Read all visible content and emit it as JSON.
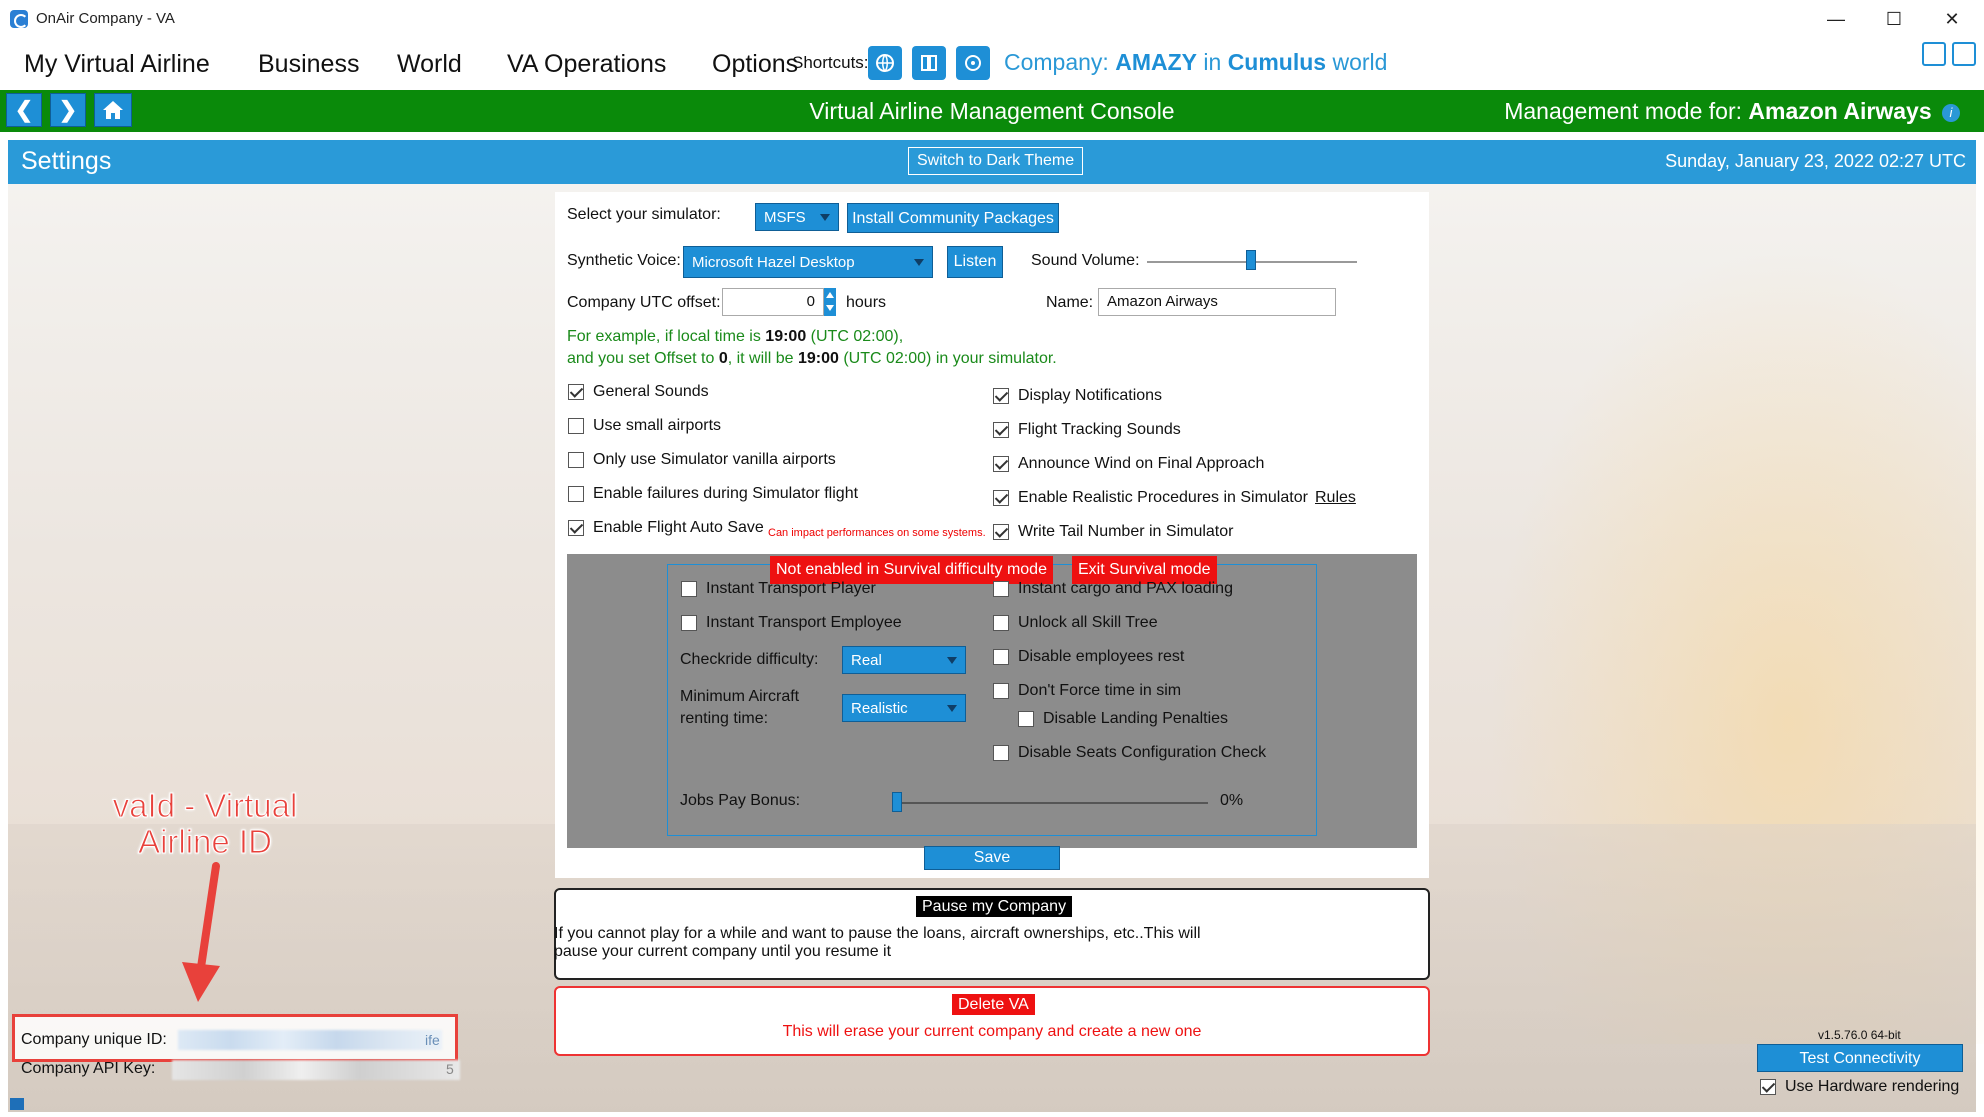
{
  "window": {
    "title": "OnAir Company - VA",
    "minimize_glyph": "—",
    "maximize_glyph": "☐",
    "close_glyph": "✕"
  },
  "menu": {
    "items": [
      "My Virtual Airline",
      "Business",
      "World",
      "VA Operations",
      "Options"
    ],
    "shortcuts_label": "Shortcuts:",
    "shortcut_icons": [
      "globe-icon",
      "map-book-icon",
      "refresh-badge-icon"
    ],
    "company_prefix": "Company:",
    "company_name": "AMAZY",
    "company_in": "in",
    "world_name": "Cumulus",
    "world_suffix": "world"
  },
  "navbar": {
    "back_glyph": "❮",
    "forward_glyph": "❯",
    "home_glyph": "⌂",
    "console_title": "Virtual Airline Management Console",
    "mgmt_prefix": "Management mode for:",
    "mgmt_company": "Amazon Airways",
    "info_glyph": "i"
  },
  "settings_header": {
    "title": "Settings",
    "theme_button": "Switch to Dark Theme",
    "datetime": "Sunday, January 23, 2022 02:27 UTC"
  },
  "settings": {
    "simulator_label": "Select your simulator:",
    "simulator_value": "MSFS",
    "install_packages_button": "Install Community Packages",
    "voice_label": "Synthetic Voice:",
    "voice_value": "Microsoft Hazel Desktop",
    "listen_button": "Listen",
    "sound_volume_label": "Sound Volume:",
    "sound_volume_level": 0.5,
    "utc_offset_label": "Company UTC offset:",
    "utc_offset_value": "0",
    "hours_label": "hours",
    "name_label": "Name:",
    "name_value": "Amazon Airways",
    "example_line1_a": "For example, if local time is",
    "example_line1_b": "19:00",
    "example_line1_c": "(UTC 02:00),",
    "example_line2_a": "and you set Offset to",
    "example_line2_b": "0",
    "example_line2_c": ", it will be",
    "example_line2_d": "19:00",
    "example_line2_e": "(UTC 02:00) in your simulator.",
    "left_checkboxes": [
      {
        "label": "General Sounds",
        "checked": true
      },
      {
        "label": "Use small airports",
        "checked": false
      },
      {
        "label": "Only use Simulator vanilla airports",
        "checked": false
      },
      {
        "label": "Enable failures during Simulator flight",
        "checked": false
      },
      {
        "label": "Enable Flight Auto Save",
        "checked": true
      }
    ],
    "autosave_warning": "Can impact performances on some systems.",
    "right_checkboxes": [
      {
        "label": "Display Notifications",
        "checked": true
      },
      {
        "label": "Flight Tracking Sounds",
        "checked": true
      },
      {
        "label": "Announce Wind on Final Approach",
        "checked": true
      },
      {
        "label": "Enable Realistic Procedures in Simulator",
        "checked": true
      },
      {
        "label": "Write Tail Number in Simulator",
        "checked": true
      }
    ],
    "rules_link": "Rules",
    "save_button": "Save"
  },
  "survival": {
    "not_enabled_banner": "Not enabled in Survival difficulty mode",
    "exit_button": "Exit Survival mode",
    "left_checkboxes": [
      "Instant Transport Player",
      "Instant Transport Employee"
    ],
    "checkride_label": "Checkride difficulty:",
    "checkride_value": "Real",
    "min_renting_label_1": "Minimum Aircraft",
    "min_renting_label_2": "renting time:",
    "min_renting_value": "Realistic",
    "right_checkboxes": [
      "Instant cargo and PAX loading",
      "Unlock all Skill Tree",
      "Disable employees rest",
      "Don't Force time in sim"
    ],
    "disable_landing_penalties": "Disable Landing Penalties",
    "disable_seats_check": "Disable Seats Configuration Check",
    "jobs_pay_label": "Jobs Pay Bonus:",
    "jobs_pay_value": "0%",
    "jobs_pay_level": 0
  },
  "pause": {
    "button": "Pause my Company",
    "text_line1": "If you cannot play for a while and want to pause the loans, aircraft ownerships, etc..This will",
    "text_line2": "pause your current company until you resume it"
  },
  "delete": {
    "button": "Delete VA",
    "text": "This will erase your current company and create a new one"
  },
  "bottom_left": {
    "annotation_line1": "vaId - Virtual",
    "annotation_line2": "Airline ID",
    "company_id_label": "Company unique ID:",
    "company_id_tail": "ife",
    "api_key_label": "Company API Key:",
    "api_key_tail": "5"
  },
  "bottom_right": {
    "version": "v1.5.76.0 64-bit",
    "test_button": "Test Connectivity",
    "hw_render_label": "Use Hardware rendering",
    "hw_render_checked": true
  }
}
